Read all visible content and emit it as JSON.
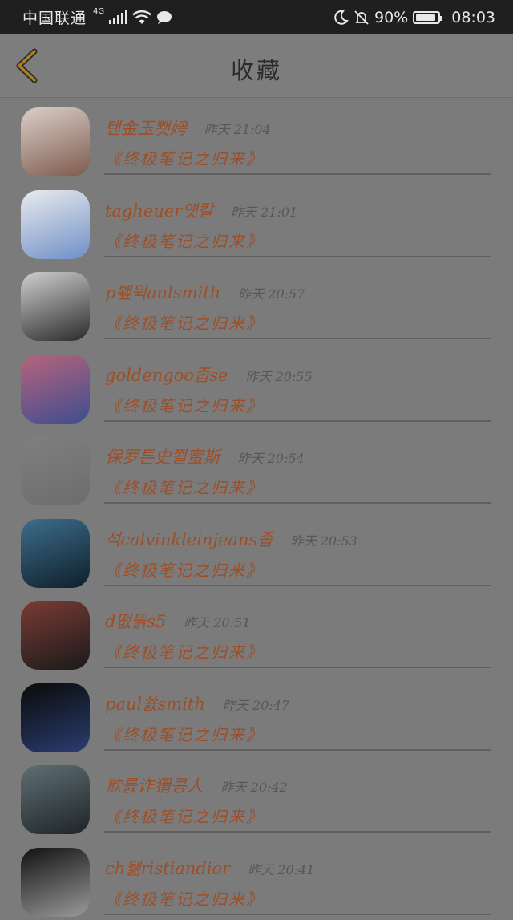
{
  "status_bar": {
    "carrier": "中国联通",
    "network": "4G",
    "battery": "90%",
    "time": "08:03"
  },
  "header": {
    "title": "收藏"
  },
  "items": [
    {
      "name": "텐金玉뾋娉",
      "time": "昨天 21:04",
      "book": "《终极笔记之归来》",
      "avatar_colors": [
        "#d9cfc9",
        "#7f5a4d"
      ]
    },
    {
      "name": "tagheuer얫칼",
      "time": "昨天 21:01",
      "book": "《终极笔记之归来》",
      "avatar_colors": [
        "#e9ebee",
        "#6f8fc7"
      ]
    },
    {
      "name": "p뵆윅aulsmith",
      "time": "昨天 20:57",
      "book": "《终极笔记之归来》",
      "avatar_colors": [
        "#cfcfcf",
        "#2b2b2b"
      ]
    },
    {
      "name": "goldengoo좁se",
      "time": "昨天 20:55",
      "book": "《终极笔记之归来》",
      "avatar_colors": [
        "#b7647c",
        "#3e4d8f"
      ]
    },
    {
      "name": "保罗튼史쬘蜜斯",
      "time": "昨天 20:54",
      "book": "《终极笔记之归来》",
      "avatar_colors": [
        "#7f7f7f",
        "#6d6d6d"
      ]
    },
    {
      "name": "석calvinkleinjeans좁",
      "time": "昨天 20:53",
      "book": "《终极笔记之归来》",
      "avatar_colors": [
        "#3d6d8c",
        "#0f1f2b"
      ]
    },
    {
      "name": "d떲뚥s5",
      "time": "昨天 20:51",
      "book": "《终极笔记之归来》",
      "avatar_colors": [
        "#7a3b35",
        "#1a1a1a"
      ]
    },
    {
      "name": "paul쑔smith",
      "time": "昨天 20:47",
      "book": "《终极笔记之归来》",
      "avatar_colors": [
        "#0a0a0a",
        "#2a3d6f"
      ]
    },
    {
      "name": "欺릀诈猾콩人",
      "time": "昨天 20:42",
      "book": "《终极笔记之归来》",
      "avatar_colors": [
        "#5f6f74",
        "#1e2428"
      ]
    },
    {
      "name": "ch뒒ristiandior",
      "time": "昨天 20:41",
      "book": "《终极笔记之归来》",
      "avatar_colors": [
        "#111111",
        "#9a9a9a"
      ]
    }
  ]
}
